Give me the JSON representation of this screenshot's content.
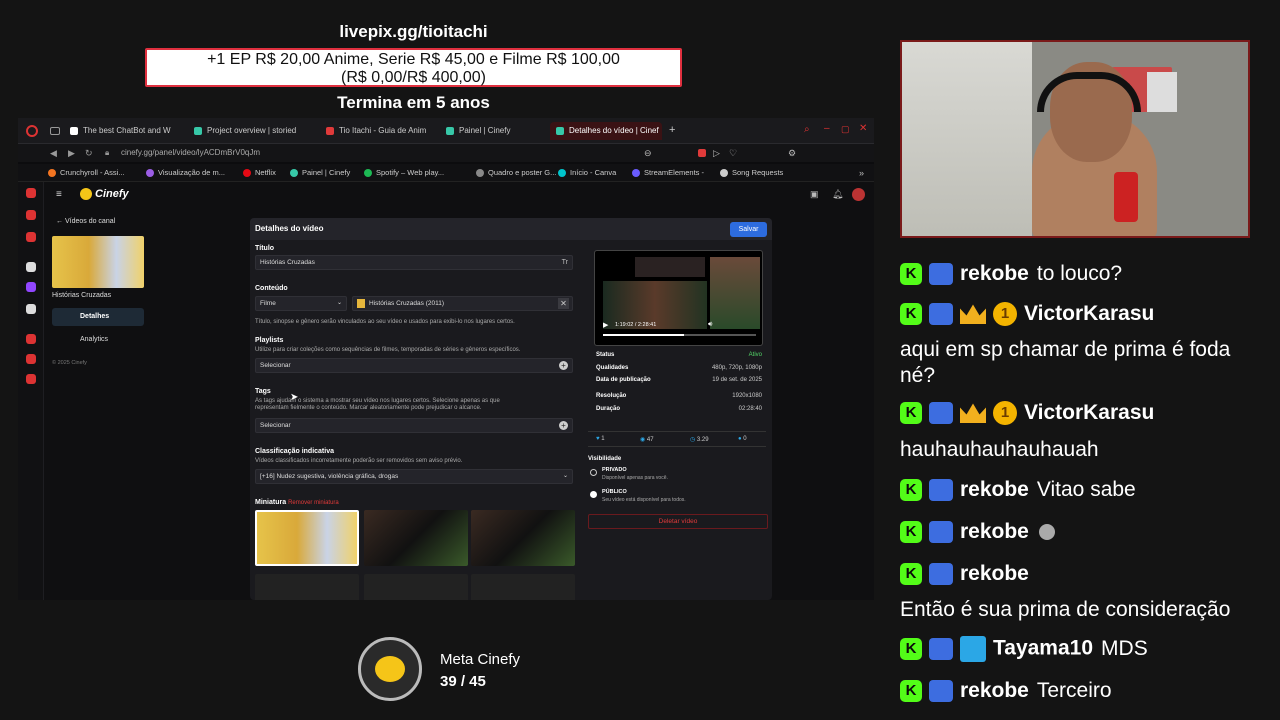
{
  "overlay": {
    "livepix_url": "livepix.gg/tioitachi",
    "goal_line1": "+1 EP R$ 20,00 Anime, Serie R$ 45,00 e Filme R$ 100,00",
    "goal_line2": "(R$ 0,00/R$ 400,00)",
    "goal_progress": 0.0,
    "ends": "Termina em 5 anos"
  },
  "browser": {
    "tabs": [
      {
        "label": "The best ChatBot and W",
        "icon_color": "#ffffff"
      },
      {
        "label": "Project overview | storied",
        "icon_color": "#37c8a8"
      },
      {
        "label": "Tio Itachi - Guia de Anim",
        "icon_color": "#e03a3a"
      },
      {
        "label": "Painel | Cinefy",
        "icon_color": "#37c8a8"
      },
      {
        "label": "Detalhes do vídeo | Cinef",
        "icon_color": "#37c8a8"
      }
    ],
    "url": "cinefy.gg/panel/video/lyACDmBrV0qJm",
    "bookmarks": [
      {
        "label": "Crunchyroll - Assi...",
        "icon_color": "#f47521"
      },
      {
        "label": "Visualização de m...",
        "icon_color": "#9b5de5"
      },
      {
        "label": "Netflix",
        "icon_color": "#e50914"
      },
      {
        "label": "Painel | Cinefy",
        "icon_color": "#37c8a8"
      },
      {
        "label": "Spotify – Web play...",
        "icon_color": "#1db954"
      },
      {
        "label": "Quadro e poster G...",
        "icon_color": "#888888"
      },
      {
        "label": "Início - Canva",
        "icon_color": "#00c4cc"
      },
      {
        "label": "StreamElements -",
        "icon_color": "#6a5cff"
      },
      {
        "label": "Song Requests",
        "icon_color": "#cccccc"
      }
    ]
  },
  "cinefy": {
    "brand": "Cinefy",
    "back_label": "Vídeos do canal",
    "video_title_side": "Histórias Cruzadas",
    "nav": [
      "Detalhes",
      "Analytics"
    ],
    "copyright": "© 2025 Cinefy",
    "panel_title": "Detalhes do vídeo",
    "save": "Salvar",
    "titulo_label": "Título",
    "titulo_value": "Histórias Cruzadas",
    "conteudo_label": "Conteúdo",
    "conteudo_type": "Filme",
    "conteudo_value": "Histórias Cruzadas (2011)",
    "conteudo_hint": "Título, sinopse e gênero serão vinculados ao seu vídeo e usados para exibi-lo nos lugares certos.",
    "playlists_label": "Playlists",
    "playlists_hint": "Utilize para criar coleções como sequências de filmes, temporadas de séries e gêneros específicos.",
    "select": "Selecionar",
    "tags_label": "Tags",
    "tags_hint1": "As tags ajudam o sistema a mostrar seu vídeo nos lugares certos. Selecione apenas as que",
    "tags_hint2": "representam fielmente o conteúdo. Marcar aleatoriamente pode prejudicar o alcance.",
    "rating_label": "Classificação indicativa",
    "rating_hint": "Vídeos classificados incorretamente poderão ser removidos sem aviso prévio.",
    "rating_value": "[+16] Nudez sugestiva, violência gráfica, drogas",
    "thumb_label": "Miniatura",
    "thumb_remove": "Remover miniatura",
    "player_time": "1:19:02 / 2:28:41",
    "stats": [
      {
        "k": "Status",
        "v": "Ativo"
      },
      {
        "k": "Qualidades",
        "v": "480p, 720p, 1080p"
      },
      {
        "k": "Data de publicação",
        "v": "19 de set. de 2025"
      },
      {
        "k": "Resolução",
        "v": "1920x1080"
      },
      {
        "k": "Duração",
        "v": "02:28:40"
      }
    ],
    "metrics": [
      "1",
      "47",
      "3.29",
      "0"
    ],
    "vis_label": "Visibilidade",
    "private": "PRIVADO",
    "private_hint": "Disponível apenas para você.",
    "public": "PÚBLICO",
    "public_hint": "Seu vídeo está disponível para todos.",
    "delete": "Deletar vídeo"
  },
  "chat": [
    {
      "user": "rekobe",
      "msg": "to louco?",
      "sub": false,
      "inline": true
    },
    {
      "user": "VictorKarasu",
      "msg": "aqui em sp chamar de prima é foda",
      "msg2": "né?",
      "sub": true,
      "inline": false
    },
    {
      "user": "VictorKarasu",
      "msg": "hauhauhauhauhauah",
      "sub": true,
      "inline": false
    },
    {
      "user": "rekobe",
      "msg": "Vitao sabe",
      "sub": false,
      "inline": true
    },
    {
      "user": "rekobe",
      "msg": "",
      "sub": false,
      "inline": true
    },
    {
      "user": "rekobe",
      "msg": "Então é sua prima de consideração",
      "sub": false,
      "inline": false
    },
    {
      "user": "Tayama10",
      "msg": "MDS",
      "sub": false,
      "inline": true
    },
    {
      "user": "rekobe",
      "msg": "Terceiro",
      "sub": false,
      "inline": true
    }
  ],
  "badge_one": "1",
  "meta": {
    "label": "Meta Cinefy",
    "count": "39 / 45"
  }
}
